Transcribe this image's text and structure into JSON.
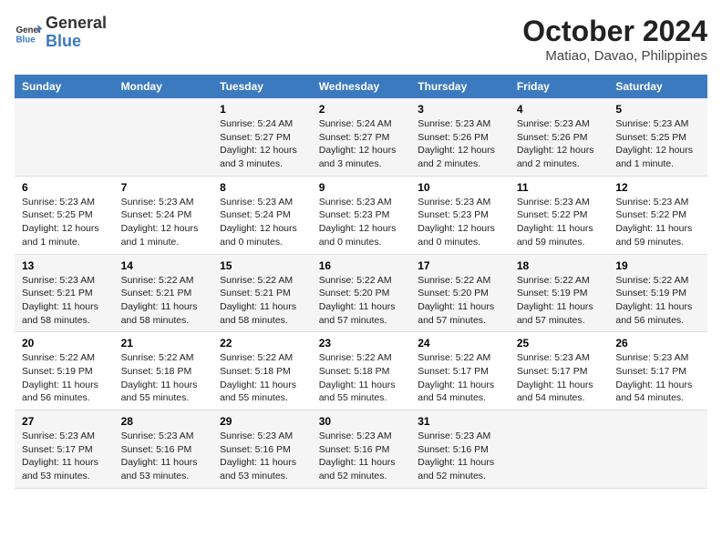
{
  "logo": {
    "line1": "General",
    "line2": "Blue"
  },
  "title": "October 2024",
  "subtitle": "Matiao, Davao, Philippines",
  "days_of_week": [
    "Sunday",
    "Monday",
    "Tuesday",
    "Wednesday",
    "Thursday",
    "Friday",
    "Saturday"
  ],
  "weeks": [
    [
      {
        "day": "",
        "info": ""
      },
      {
        "day": "",
        "info": ""
      },
      {
        "day": "1",
        "info": "Sunrise: 5:24 AM\nSunset: 5:27 PM\nDaylight: 12 hours and 3 minutes."
      },
      {
        "day": "2",
        "info": "Sunrise: 5:24 AM\nSunset: 5:27 PM\nDaylight: 12 hours and 3 minutes."
      },
      {
        "day": "3",
        "info": "Sunrise: 5:23 AM\nSunset: 5:26 PM\nDaylight: 12 hours and 2 minutes."
      },
      {
        "day": "4",
        "info": "Sunrise: 5:23 AM\nSunset: 5:26 PM\nDaylight: 12 hours and 2 minutes."
      },
      {
        "day": "5",
        "info": "Sunrise: 5:23 AM\nSunset: 5:25 PM\nDaylight: 12 hours and 1 minute."
      }
    ],
    [
      {
        "day": "6",
        "info": "Sunrise: 5:23 AM\nSunset: 5:25 PM\nDaylight: 12 hours and 1 minute."
      },
      {
        "day": "7",
        "info": "Sunrise: 5:23 AM\nSunset: 5:24 PM\nDaylight: 12 hours and 1 minute."
      },
      {
        "day": "8",
        "info": "Sunrise: 5:23 AM\nSunset: 5:24 PM\nDaylight: 12 hours and 0 minutes."
      },
      {
        "day": "9",
        "info": "Sunrise: 5:23 AM\nSunset: 5:23 PM\nDaylight: 12 hours and 0 minutes."
      },
      {
        "day": "10",
        "info": "Sunrise: 5:23 AM\nSunset: 5:23 PM\nDaylight: 12 hours and 0 minutes."
      },
      {
        "day": "11",
        "info": "Sunrise: 5:23 AM\nSunset: 5:22 PM\nDaylight: 11 hours and 59 minutes."
      },
      {
        "day": "12",
        "info": "Sunrise: 5:23 AM\nSunset: 5:22 PM\nDaylight: 11 hours and 59 minutes."
      }
    ],
    [
      {
        "day": "13",
        "info": "Sunrise: 5:23 AM\nSunset: 5:21 PM\nDaylight: 11 hours and 58 minutes."
      },
      {
        "day": "14",
        "info": "Sunrise: 5:22 AM\nSunset: 5:21 PM\nDaylight: 11 hours and 58 minutes."
      },
      {
        "day": "15",
        "info": "Sunrise: 5:22 AM\nSunset: 5:21 PM\nDaylight: 11 hours and 58 minutes."
      },
      {
        "day": "16",
        "info": "Sunrise: 5:22 AM\nSunset: 5:20 PM\nDaylight: 11 hours and 57 minutes."
      },
      {
        "day": "17",
        "info": "Sunrise: 5:22 AM\nSunset: 5:20 PM\nDaylight: 11 hours and 57 minutes."
      },
      {
        "day": "18",
        "info": "Sunrise: 5:22 AM\nSunset: 5:19 PM\nDaylight: 11 hours and 57 minutes."
      },
      {
        "day": "19",
        "info": "Sunrise: 5:22 AM\nSunset: 5:19 PM\nDaylight: 11 hours and 56 minutes."
      }
    ],
    [
      {
        "day": "20",
        "info": "Sunrise: 5:22 AM\nSunset: 5:19 PM\nDaylight: 11 hours and 56 minutes."
      },
      {
        "day": "21",
        "info": "Sunrise: 5:22 AM\nSunset: 5:18 PM\nDaylight: 11 hours and 55 minutes."
      },
      {
        "day": "22",
        "info": "Sunrise: 5:22 AM\nSunset: 5:18 PM\nDaylight: 11 hours and 55 minutes."
      },
      {
        "day": "23",
        "info": "Sunrise: 5:22 AM\nSunset: 5:18 PM\nDaylight: 11 hours and 55 minutes."
      },
      {
        "day": "24",
        "info": "Sunrise: 5:22 AM\nSunset: 5:17 PM\nDaylight: 11 hours and 54 minutes."
      },
      {
        "day": "25",
        "info": "Sunrise: 5:23 AM\nSunset: 5:17 PM\nDaylight: 11 hours and 54 minutes."
      },
      {
        "day": "26",
        "info": "Sunrise: 5:23 AM\nSunset: 5:17 PM\nDaylight: 11 hours and 54 minutes."
      }
    ],
    [
      {
        "day": "27",
        "info": "Sunrise: 5:23 AM\nSunset: 5:17 PM\nDaylight: 11 hours and 53 minutes."
      },
      {
        "day": "28",
        "info": "Sunrise: 5:23 AM\nSunset: 5:16 PM\nDaylight: 11 hours and 53 minutes."
      },
      {
        "day": "29",
        "info": "Sunrise: 5:23 AM\nSunset: 5:16 PM\nDaylight: 11 hours and 53 minutes."
      },
      {
        "day": "30",
        "info": "Sunrise: 5:23 AM\nSunset: 5:16 PM\nDaylight: 11 hours and 52 minutes."
      },
      {
        "day": "31",
        "info": "Sunrise: 5:23 AM\nSunset: 5:16 PM\nDaylight: 11 hours and 52 minutes."
      },
      {
        "day": "",
        "info": ""
      },
      {
        "day": "",
        "info": ""
      }
    ]
  ]
}
